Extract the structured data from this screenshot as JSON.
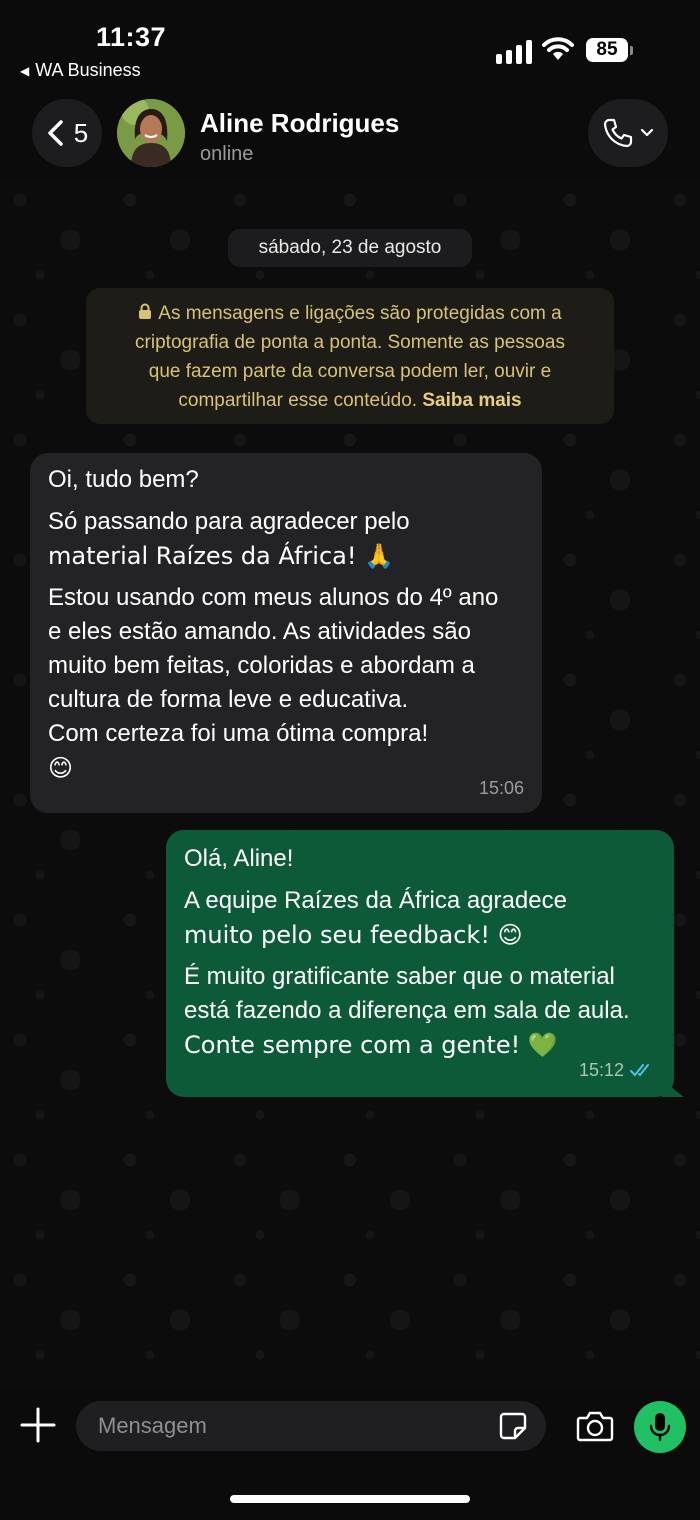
{
  "status_bar": {
    "time": "11:37",
    "back_app": "WA Business",
    "battery": "85"
  },
  "header": {
    "back_count": "5",
    "contact_name": "Aline Rodrigues",
    "contact_status": "online",
    "back_icon": "chevron-left-icon",
    "call_icon": "phone-icon"
  },
  "chat": {
    "date_chip": "sábado, 23 de agosto",
    "encryption": {
      "line1": "As mensagens e ligações são protegidas com a",
      "line2": "criptografia de ponta a ponta. Somente as pessoas",
      "line3": "que fazem parte da conversa podem ler, ouvir e",
      "line4": "compartilhar esse conteúdo.",
      "link": "Saiba mais"
    },
    "incoming": {
      "p1": "Oi, tudo bem?",
      "p2_l1": "Só passando para agradecer pelo",
      "p2_l2": "material Raízes da África! 🙏",
      "p3_l1": "Estou usando com meus alunos do 4º ano",
      "p3_l2": "e eles estão amando. As atividades são",
      "p3_l3": "muito bem feitas, coloridas e abordam a",
      "p3_l4": "cultura de forma leve e educativa.",
      "p3_l5": "Com certeza foi uma ótima compra!",
      "p3_l6": "😊",
      "time": "15:06"
    },
    "outgoing": {
      "p1": "Olá, Aline!",
      "p2_l1": "A equipe Raízes da África agradece",
      "p2_l2": "muito pelo seu feedback! 😊",
      "p3_l1": "É muito gratificante saber que o material",
      "p3_l2": "está fazendo a diferença em sala de aula.",
      "p3_l3": "Conte sempre com a gente! 💚",
      "time": "15:12",
      "status": "read"
    }
  },
  "input_bar": {
    "placeholder": "Mensagem"
  },
  "colors": {
    "accent_green": "#21c063",
    "outgoing_bubble": "#0c5a37",
    "incoming_bubble": "#232325",
    "read_ticks": "#53bdeb"
  }
}
